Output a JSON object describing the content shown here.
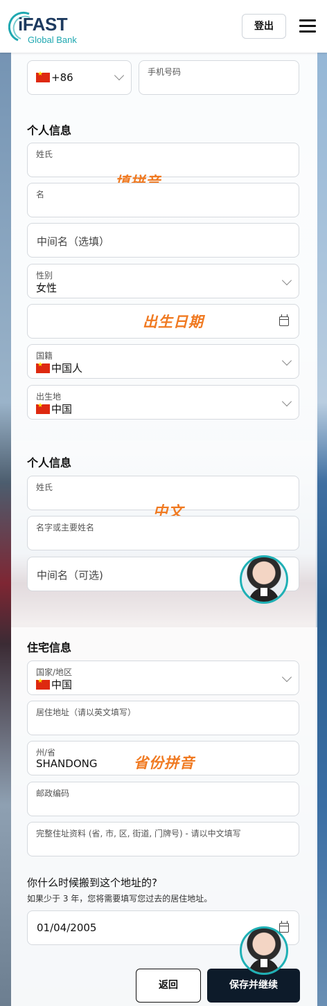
{
  "header": {
    "logo_title": "iFAST",
    "logo_subtitle": "Global Bank",
    "logout_label": "登出"
  },
  "phone": {
    "country_code": "+86",
    "number_label": "手机号码"
  },
  "personal_info": {
    "title": "个人信息",
    "surname_label": "姓氏",
    "given_name_label": "名",
    "middle_name_placeholder": "中间名（选填）",
    "gender_label": "性别",
    "gender_value": "女性",
    "nationality_label": "国籍",
    "nationality_value": "中国人",
    "birthplace_label": "出生地",
    "birthplace_value": "中国"
  },
  "personal_info_native": {
    "title": "个人信息",
    "surname_label": "姓氏",
    "name_label": "名字或主要姓名",
    "middle_name_placeholder": "中间名（可选)"
  },
  "residential_info": {
    "title": "住宅信息",
    "country_label": "国家/地区",
    "country_value": "中国",
    "address_label": "居住地址（请以英文填写）",
    "state_label": "州/省",
    "state_value": "SHANDONG",
    "postcode_label": "邮政编码",
    "full_address_label": "完整住址资料 (省, 市, 区, 街道, 门牌号) - 请以中文填写",
    "moved_question": "你什么时候搬到这个地址的?",
    "moved_hint": "如果少于 3 年，您将需要填写您过去的居住地址。",
    "moved_date": "01/04/2005"
  },
  "annotations": {
    "pinyin_fill": "填拼音",
    "birth_date": "出生日期",
    "chinese": "中文",
    "province_pinyin": "省份拼音"
  },
  "actions": {
    "back_label": "返回",
    "save_label": "保存并继续"
  },
  "colors": {
    "brand_navy": "#1d3a5f",
    "brand_teal": "#1fa8b1",
    "annotation_orange": "#f07a22",
    "primary_button": "#0d1b2a"
  }
}
